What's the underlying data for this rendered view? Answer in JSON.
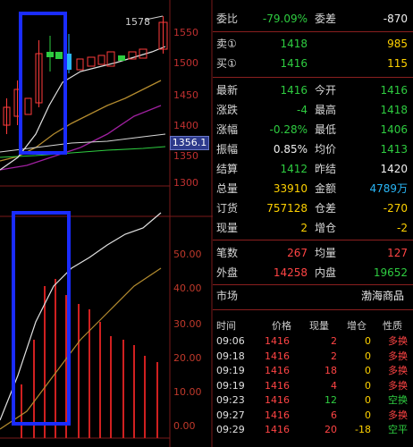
{
  "chart": {
    "peak_label": "1578",
    "current_price_tag": "1356.1",
    "price_axis": [
      "1550",
      "1500",
      "1450",
      "1400",
      "1350",
      "1300"
    ],
    "volume_axis": [
      "50.00",
      "40.00",
      "30.00",
      "20.00",
      "10.00",
      "0.00"
    ]
  },
  "quote": {
    "weibi_label": "委比",
    "weibi_value": "-79.09%",
    "weicha_label": "委差",
    "weicha_value": "-870",
    "sell1_label": "卖①",
    "sell1_price": "1418",
    "sell1_qty": "985",
    "buy1_label": "买①",
    "buy1_price": "1416",
    "buy1_qty": "115",
    "rows": [
      {
        "l1": "最新",
        "v1": "1416",
        "c1": "green",
        "l2": "今开",
        "v2": "1416",
        "c2": "green"
      },
      {
        "l1": "涨跌",
        "v1": "-4",
        "c1": "green",
        "l2": "最高",
        "v2": "1418",
        "c2": "green"
      },
      {
        "l1": "涨幅",
        "v1": "-0.28%",
        "c1": "green",
        "l2": "最低",
        "v2": "1406",
        "c2": "green"
      },
      {
        "l1": "振幅",
        "v1": "0.85%",
        "c1": "white",
        "l2": "均价",
        "v2": "1413",
        "c2": "green"
      },
      {
        "l1": "结算",
        "v1": "1412",
        "c1": "green",
        "l2": "昨结",
        "v2": "1420",
        "c2": "white"
      },
      {
        "l1": "总量",
        "v1": "33910",
        "c1": "yellow",
        "l2": "金额",
        "v2": "4789万",
        "c2": "cyan"
      },
      {
        "l1": "订货",
        "v1": "757128",
        "c1": "yellow",
        "l2": "仓差",
        "v2": "-270",
        "c2": "yellow"
      },
      {
        "l1": "现量",
        "v1": "2",
        "c1": "yellow",
        "l2": "增仓",
        "v2": "-2",
        "c2": "yellow"
      }
    ],
    "bishu_label": "笔数",
    "bishu_value": "267",
    "junliang_label": "均量",
    "junliang_value": "127",
    "waipan_label": "外盘",
    "waipan_value": "14258",
    "neipan_label": "内盘",
    "neipan_value": "19652",
    "market_label": "市场",
    "market_value": "渤海商品"
  },
  "trades": {
    "headers": {
      "time": "时间",
      "price": "价格",
      "volume": "现量",
      "oi": "增仓",
      "nature": "性质"
    },
    "rows": [
      {
        "time": "09:06",
        "price": "1416",
        "vol": "2",
        "vc": "red",
        "oi": "0",
        "nat": "多换",
        "nc": "red"
      },
      {
        "time": "09:18",
        "price": "1416",
        "vol": "2",
        "vc": "red",
        "oi": "0",
        "nat": "多换",
        "nc": "red"
      },
      {
        "time": "09:19",
        "price": "1416",
        "vol": "18",
        "vc": "red",
        "oi": "0",
        "nat": "多换",
        "nc": "red"
      },
      {
        "time": "09:19",
        "price": "1416",
        "vol": "4",
        "vc": "red",
        "oi": "0",
        "nat": "多换",
        "nc": "red"
      },
      {
        "time": "09:23",
        "price": "1416",
        "vol": "12",
        "vc": "green",
        "oi": "0",
        "nat": "空换",
        "nc": "green"
      },
      {
        "time": "09:27",
        "price": "1416",
        "vol": "6",
        "vc": "red",
        "oi": "0",
        "nat": "多换",
        "nc": "red"
      },
      {
        "time": "09:29",
        "price": "1416",
        "vol": "20",
        "vc": "red",
        "oi": "-18",
        "nat": "空平",
        "nc": "green"
      }
    ]
  }
}
